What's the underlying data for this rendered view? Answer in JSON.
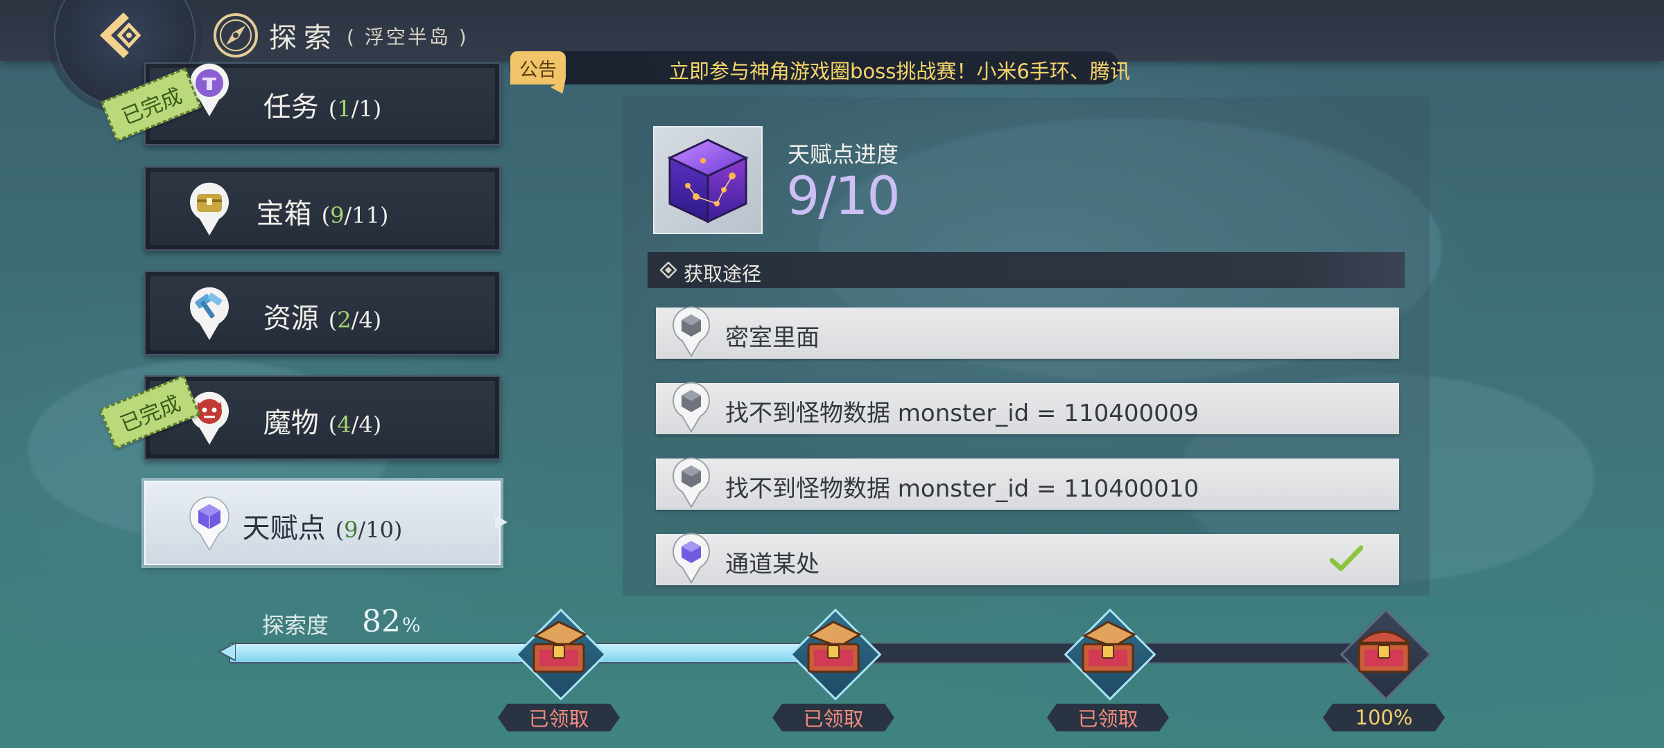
{
  "header": {
    "title": "探索",
    "subtitle": "( 浮空半岛 )"
  },
  "notice": {
    "tag": "公告",
    "text": "立即参与神角游戏圈boss挑战赛！小米6手环、腾讯"
  },
  "categories": [
    {
      "name": "任务",
      "done": "1",
      "total": "1",
      "completed": true,
      "stamp": "已完成",
      "icon": "quest-icon"
    },
    {
      "name": "宝箱",
      "done": "9",
      "total": "11",
      "completed": false,
      "icon": "treasure-chest-icon"
    },
    {
      "name": "资源",
      "done": "2",
      "total": "4",
      "completed": false,
      "icon": "hammer-icon"
    },
    {
      "name": "魔物",
      "done": "4",
      "total": "4",
      "completed": true,
      "stamp": "已完成",
      "icon": "monster-icon"
    },
    {
      "name": "天赋点",
      "done": "9",
      "total": "10",
      "completed": false,
      "active": true,
      "icon": "talent-cube-icon"
    }
  ],
  "detail": {
    "label": "天赋点进度",
    "progress": "9/10",
    "sources_title": "获取途径",
    "sources": [
      {
        "text": "密室里面",
        "collected": false
      },
      {
        "text": "找不到怪物数据 monster_id = 110400009",
        "collected": false
      },
      {
        "text": "找不到怪物数据 monster_id = 110400010",
        "collected": false
      },
      {
        "text": "通道某处",
        "collected": true
      }
    ]
  },
  "exploration": {
    "label": "探索度",
    "value": "82",
    "unit": "%",
    "fraction": 0.82,
    "rewards": [
      {
        "label": "已领取",
        "claimed": true
      },
      {
        "label": "已领取",
        "claimed": true
      },
      {
        "label": "已领取",
        "claimed": true
      },
      {
        "label": "100%",
        "claimed": false
      }
    ]
  },
  "colors": {
    "accent_green": "#a6d670",
    "progress_purple": "#cdbff5",
    "notice_gold": "#f6d56a",
    "claimed_red": "#f08c7f"
  }
}
